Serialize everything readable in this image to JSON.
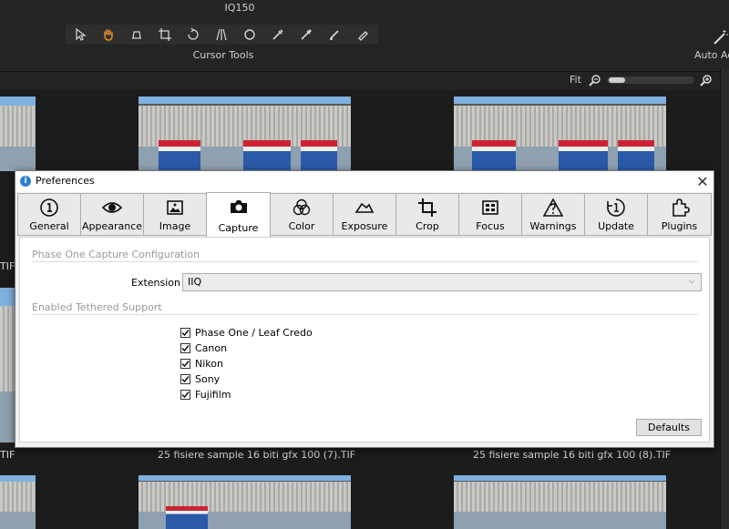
{
  "toolbar": {
    "camera": "IQ150",
    "cursor_tools_label": "Cursor Tools",
    "auto_adjust_label": "Auto Ad",
    "tools": [
      "select-tool-icon",
      "pan-hand-tool-icon",
      "loupe-tool-icon",
      "crop-tool-icon",
      "rotate-tool-icon",
      "keystone-tool-icon",
      "spot-removal-tool-icon",
      "color-picker-tool-icon",
      "white-balance-picker-tool-icon",
      "brush-tool-icon",
      "eraser-tool-icon"
    ],
    "accent": "#e8912a"
  },
  "viewer": {
    "fit_label": "Fit"
  },
  "browser": {
    "captions": [
      "TIF",
      "25 fisiere sample 16 biti gfx 100 (7).TIF",
      "25 fisiere sample 16 biti gfx 100 (8).TIF",
      "TIF"
    ]
  },
  "dialog": {
    "title": "Preferences",
    "close": "✕",
    "tabs": [
      {
        "label": "General",
        "icon": "info-circle-icon"
      },
      {
        "label": "Appearance",
        "icon": "eye-icon"
      },
      {
        "label": "Image",
        "icon": "image-icon"
      },
      {
        "label": "Capture",
        "icon": "camera-icon",
        "active": true
      },
      {
        "label": "Color",
        "icon": "color-circles-icon"
      },
      {
        "label": "Exposure",
        "icon": "exposure-icon"
      },
      {
        "label": "Crop",
        "icon": "crop-icon"
      },
      {
        "label": "Focus",
        "icon": "focus-icon"
      },
      {
        "label": "Warnings",
        "icon": "warning-icon"
      },
      {
        "label": "Update",
        "icon": "update-icon"
      },
      {
        "label": "Plugins",
        "icon": "puzzle-icon"
      }
    ],
    "capture": {
      "config_heading": "Phase One Capture Configuration",
      "extension_label": "Extension",
      "extension_value": "IIQ",
      "tethered_heading": "Enabled Tethered Support",
      "tethered": [
        {
          "label": "Phase One / Leaf Credo",
          "checked": true
        },
        {
          "label": "Canon",
          "checked": true
        },
        {
          "label": "Nikon",
          "checked": true
        },
        {
          "label": "Sony",
          "checked": true
        },
        {
          "label": "Fujifilm",
          "checked": true
        }
      ],
      "defaults_button": "Defaults"
    }
  }
}
